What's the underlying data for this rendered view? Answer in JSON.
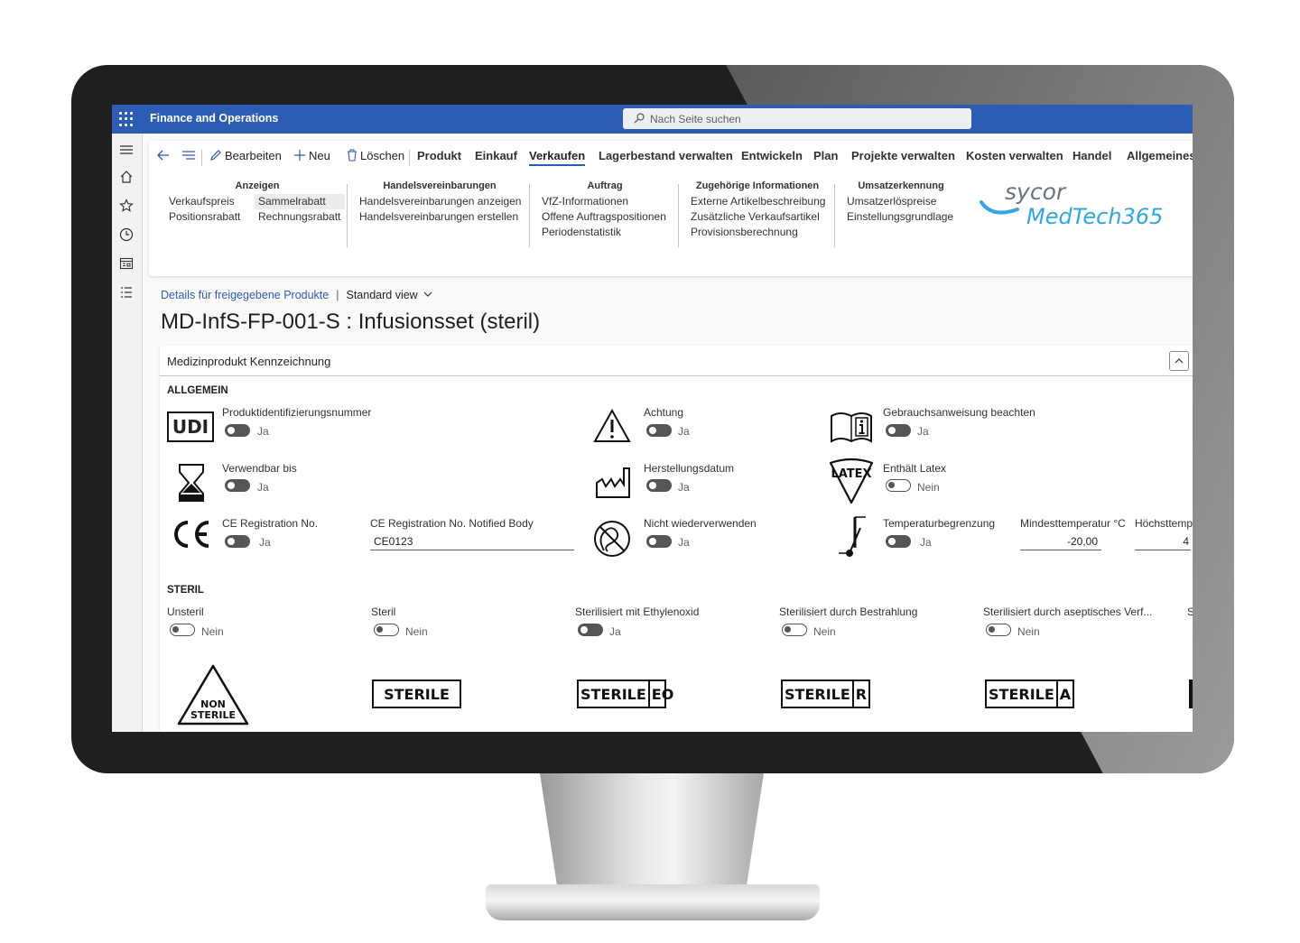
{
  "topbar": {
    "app_title": "Finance and Operations",
    "search_placeholder": "Nach Seite suchen"
  },
  "toolbar": {
    "edit": "Bearbeiten",
    "new": "Neu",
    "delete": "Löschen",
    "tabs": [
      "Produkt",
      "Einkauf",
      "Verkaufen",
      "Lagerbestand verwalten",
      "Entwickeln",
      "Plan",
      "Projekte verwalten",
      "Kosten verwalten",
      "Handel",
      "Allgemeines"
    ],
    "active_tab": "Verkaufen"
  },
  "groups": [
    {
      "title": "Anzeigen",
      "items": [
        "Verkaufspreis",
        "Sammelrabatt",
        "Positionsrabatt",
        "Rechnungsrabatt"
      ]
    },
    {
      "title": "Handelsvereinbarungen",
      "items": [
        "Handelsvereinbarungen anzeigen",
        "Handelsvereinbarungen erstellen"
      ]
    },
    {
      "title": "Auftrag",
      "items": [
        "VfZ-Informationen",
        "Offene Auftragspositionen",
        "Periodenstatistik"
      ]
    },
    {
      "title": "Zugehörige Informationen",
      "items": [
        "Externe Artikelbeschreibung",
        "Zusätzliche Verkaufsartikel",
        "Provisionsberechnung"
      ]
    },
    {
      "title": "Umsatzerkennung",
      "items": [
        "Umsatzerlöspreise",
        "Einstellungsgrundlage"
      ]
    }
  ],
  "logo": {
    "line1": "sycor",
    "line2": "MedTech365"
  },
  "breadcrumb": {
    "link": "Details für freigegebene Produkte",
    "separator": "|",
    "view": "Standard view"
  },
  "page_title": "MD-InfS-FP-001-S : Infusionsset (steril)",
  "card": {
    "title": "Medizinprodukt Kennzeichnung",
    "general_title": "ALLGEMEIN",
    "sterile_title": "STERIL",
    "general": {
      "udi": {
        "label": "Produktidentifizierungsnummer",
        "value": "Ja",
        "symbol": "UDI"
      },
      "achtung": {
        "label": "Achtung",
        "value": "Ja"
      },
      "gebrauch": {
        "label": "Gebrauchsanweisung beachten",
        "value": "Ja"
      },
      "verwendbar": {
        "label": "Verwendbar bis",
        "value": "Ja"
      },
      "herstellung": {
        "label": "Herstellungsdatum",
        "value": "Ja"
      },
      "latex": {
        "label": "Enthält Latex",
        "value": "Nein",
        "symbol": "LATEX"
      },
      "ce": {
        "label": "CE Registration No.",
        "value": "Ja"
      },
      "ce_body": {
        "label": "CE Registration No. Notified Body",
        "value": "CE0123"
      },
      "nicht_wieder": {
        "label": "Nicht wiederverwenden",
        "value": "Ja"
      },
      "temp": {
        "label": "Temperaturbegrenzung",
        "value": "Ja"
      },
      "min_temp": {
        "label": "Mindesttemperatur °C",
        "value": "-20,00"
      },
      "max_temp": {
        "label": "Höchsttemp",
        "value": "4"
      }
    },
    "sterile": [
      {
        "label": "Unsteril",
        "value": "Nein",
        "on": false
      },
      {
        "label": "Steril",
        "value": "Nein",
        "on": false
      },
      {
        "label": "Sterilisiert mit Ethylenoxid",
        "value": "Ja",
        "on": true
      },
      {
        "label": "Sterilisiert durch Bestrahlung",
        "value": "Nein",
        "on": false
      },
      {
        "label": "Sterilisiert durch aseptisches Verf...",
        "value": "Nein",
        "on": false
      },
      {
        "label": "S",
        "value": "",
        "on": false
      }
    ],
    "symbols": {
      "non_sterile_1": "NON",
      "non_sterile_2": "STERILE",
      "sterile": "STERILE",
      "sterile_eo": [
        "STERILE",
        "EO"
      ],
      "sterile_r": [
        "STERILE",
        "R"
      ],
      "sterile_a": [
        "STERILE",
        "A"
      ]
    }
  }
}
